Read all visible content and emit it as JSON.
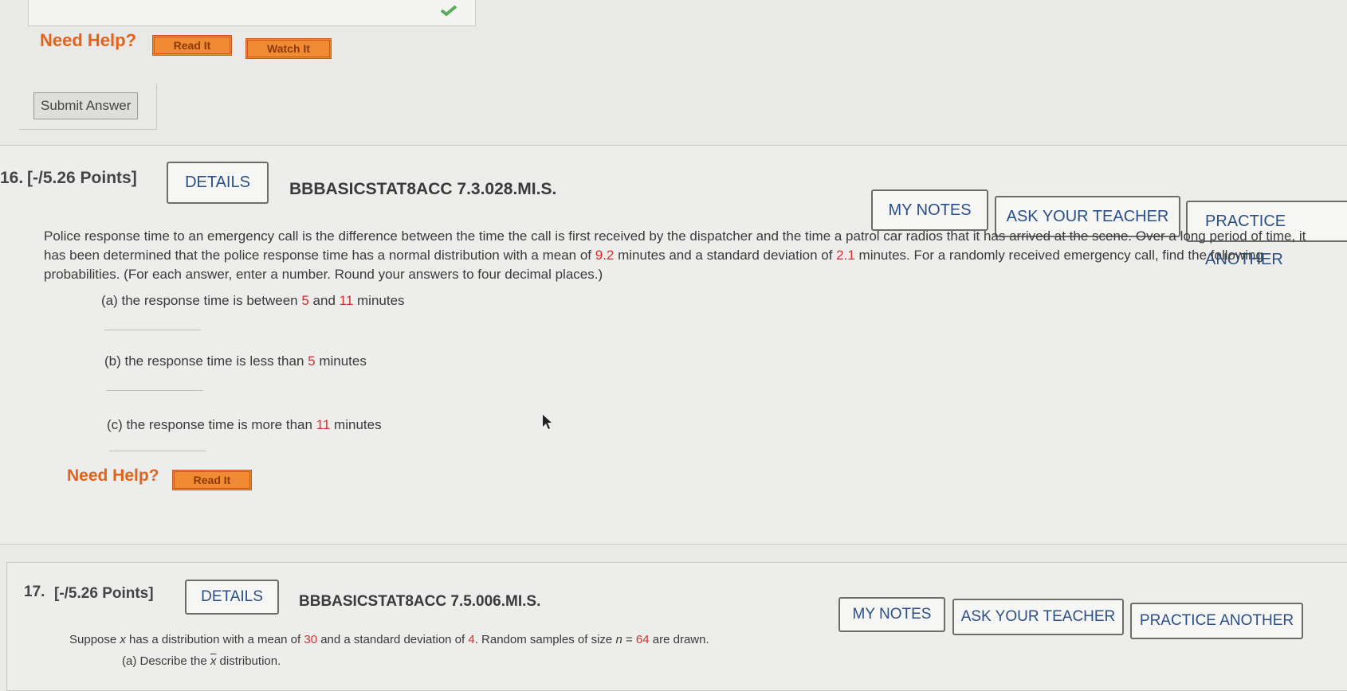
{
  "prev": {
    "need_help": "Need Help?",
    "read_it": "Read It",
    "watch_it": "Watch It",
    "submit": "Submit Answer"
  },
  "q16": {
    "number": "16.",
    "points": "[-/5.26 Points]",
    "details": "DETAILS",
    "code": "BBBASICSTAT8ACC 7.3.028.MI.S.",
    "my_notes": "MY NOTES",
    "ask_teacher": "ASK YOUR TEACHER",
    "practice": "PRACTICE ANOTHER",
    "text_1": "Police response time to an emergency call is the difference between the time the call is first received by the dispatcher and the time a patrol car radios that it has arrived at the scene. Over a long period of time, it has been determined that the police response time has a normal distribution with a mean of ",
    "mean": "9.2",
    "text_2": " minutes and a standard deviation of ",
    "sd": "2.1",
    "text_3": " minutes. For a randomly received emergency call, find the following probabilities. (For each answer, enter a number. Round your answers to four decimal places.)",
    "a_1": "(a) the response time is between ",
    "a_lo": "5",
    "a_2": " and ",
    "a_hi": "11",
    "a_3": " minutes",
    "b_1": "(b) the response time is less than ",
    "b_val": "5",
    "b_2": " minutes",
    "c_1": "(c) the response time is more than ",
    "c_val": "11",
    "c_2": " minutes",
    "need_help": "Need Help?",
    "read_it": "Read It"
  },
  "q17": {
    "number": "17.",
    "points": "[-/5.26 Points]",
    "details": "DETAILS",
    "code": "BBBASICSTAT8ACC 7.5.006.MI.S.",
    "my_notes": "MY NOTES",
    "ask_teacher": "ASK YOUR TEACHER",
    "practice": "PRACTICE ANOTHER",
    "text_1": "Suppose ",
    "var_x": "x",
    "text_2": " has a distribution with a mean of ",
    "mean": "30",
    "text_3": " and a standard deviation of ",
    "sd": "4",
    "text_4": ". Random samples of size ",
    "var_n": "n",
    "text_5": " = ",
    "n": "64",
    "text_6": " are drawn.",
    "a_1": "(a) Describe the ",
    "a_xbar": "x",
    "a_2": " distribution."
  },
  "colors": {
    "accent_orange": "#e2621b",
    "link_blue": "#2a4f86",
    "value_red": "#d62f2f"
  },
  "icons": [
    "check-icon",
    "cursor-icon"
  ]
}
